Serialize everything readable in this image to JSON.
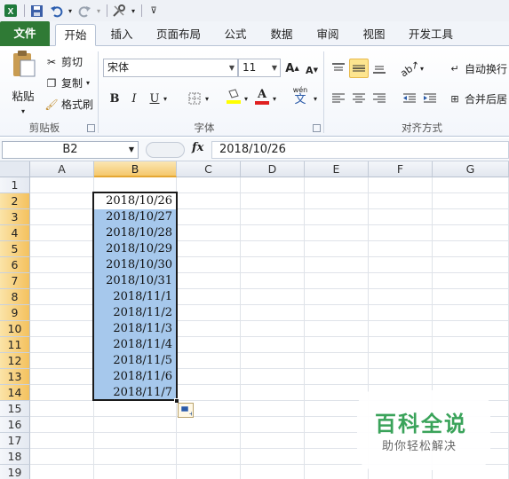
{
  "quick_access": {
    "icons": [
      "excel-logo-icon",
      "save-icon",
      "undo-icon",
      "redo-icon",
      "customize-icon"
    ]
  },
  "tabs": [
    {
      "label": "文件"
    },
    {
      "label": "开始"
    },
    {
      "label": "插入"
    },
    {
      "label": "页面布局"
    },
    {
      "label": "公式"
    },
    {
      "label": "数据"
    },
    {
      "label": "审阅"
    },
    {
      "label": "视图"
    },
    {
      "label": "开发工具"
    }
  ],
  "ribbon": {
    "clipboard": {
      "paste": "粘贴",
      "cut": "剪切",
      "copy": "复制",
      "format_painter": "格式刷",
      "group_label": "剪贴板"
    },
    "font": {
      "font_name": "宋体",
      "font_size": "11",
      "bold": "B",
      "italic": "I",
      "underline": "U",
      "increase": "A",
      "decrease": "A",
      "font_color": "A",
      "phonetic": "wén",
      "group_label": "字体"
    },
    "alignment": {
      "wrap_text": "自动换行",
      "merge_center": "合并后居",
      "group_label": "对齐方式"
    }
  },
  "formula_bar": {
    "name_box": "B2",
    "fx": "fx",
    "value": "2018/10/26"
  },
  "sheet": {
    "columns": [
      "A",
      "B",
      "C",
      "D",
      "E",
      "F",
      "G"
    ],
    "rows": [
      "1",
      "2",
      "3",
      "4",
      "5",
      "6",
      "7",
      "8",
      "9",
      "10",
      "11",
      "12",
      "13",
      "14",
      "15",
      "16",
      "17",
      "18",
      "19"
    ],
    "selected_column": "B",
    "cells_B": [
      "2018/10/26",
      "2018/10/27",
      "2018/10/28",
      "2018/10/29",
      "2018/10/30",
      "2018/10/31",
      "2018/11/1",
      "2018/11/2",
      "2018/11/3",
      "2018/11/4",
      "2018/11/5",
      "2018/11/6",
      "2018/11/7"
    ]
  },
  "watermark": {
    "title": "百科全说",
    "subtitle": "助你轻松解决"
  },
  "colors": {
    "file_tab": "#2f7a35",
    "selection_fill": "#a6c8ec",
    "header_highlight": "#f5c86c",
    "watermark_green": "#3aa35a"
  }
}
